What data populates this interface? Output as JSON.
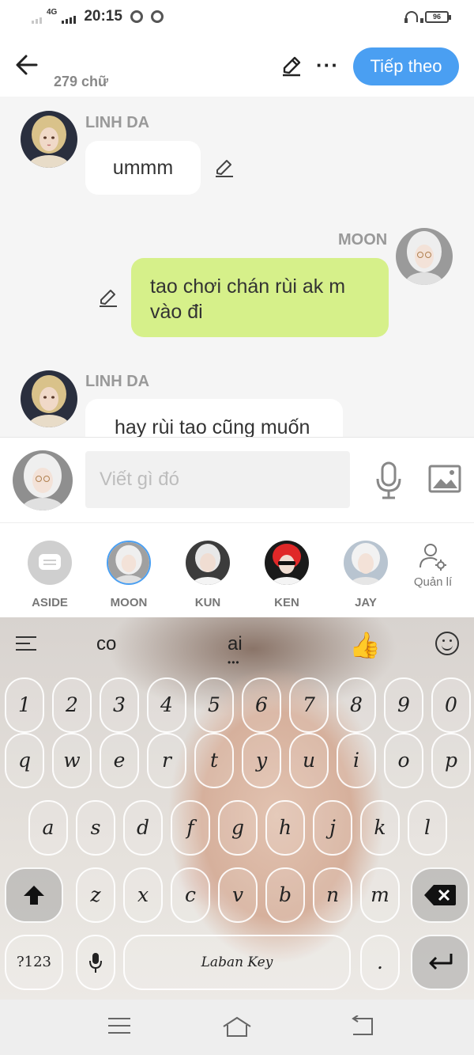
{
  "status_bar": {
    "network": "4G",
    "time": "20:15",
    "battery": "96"
  },
  "header": {
    "word_count": "279 chữ",
    "next_label": "Tiếp theo",
    "more_label": "···"
  },
  "messages": [
    {
      "sender": "LINH DA",
      "text": "ummm",
      "side": "left"
    },
    {
      "sender": "MOON",
      "text_line1": "tao chơi chán rùi ak m",
      "text_line2": "vào đi",
      "side": "right"
    },
    {
      "sender": "LINH DA",
      "text": "hay rùi tao cũng muốn",
      "side": "left"
    }
  ],
  "compose": {
    "placeholder": "Viết gì đó"
  },
  "characters": [
    {
      "label": "ASIDE"
    },
    {
      "label": "MOON",
      "selected": true
    },
    {
      "label": "KUN"
    },
    {
      "label": "KEN"
    },
    {
      "label": "JAY"
    }
  ],
  "manage_label": "Quản lí",
  "keyboard": {
    "suggestions": [
      "co",
      "ai"
    ],
    "emoji": "👍",
    "row_numbers": [
      "1",
      "2",
      "3",
      "4",
      "5",
      "6",
      "7",
      "8",
      "9",
      "0"
    ],
    "row1": [
      "q",
      "w",
      "e",
      "r",
      "t",
      "y",
      "u",
      "i",
      "o",
      "p"
    ],
    "row2": [
      "a",
      "s",
      "d",
      "f",
      "g",
      "h",
      "j",
      "k",
      "l"
    ],
    "row3": [
      "z",
      "x",
      "c",
      "v",
      "b",
      "n",
      "m"
    ],
    "symbols_label": "?123",
    "space_label": "Laban Key",
    "period_label": "."
  },
  "colors": {
    "accent": "#4a9ff2",
    "own_bubble": "#d6f08a"
  }
}
